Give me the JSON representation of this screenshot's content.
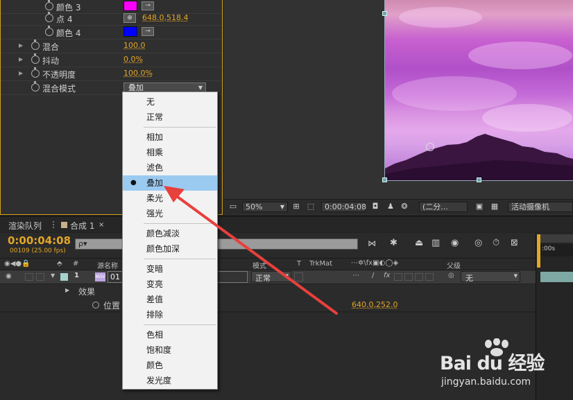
{
  "effect_controls": {
    "rows": [
      {
        "label": "颜色 3",
        "kind": "color",
        "color": "#ff00ff"
      },
      {
        "label": "点 4",
        "kind": "point",
        "value": "648.0,518.4"
      },
      {
        "label": "颜色 4",
        "kind": "color",
        "color": "#0000ff"
      },
      {
        "label": "混合",
        "kind": "value",
        "value": "100.0"
      },
      {
        "label": "抖动",
        "kind": "value",
        "value": "0.0%"
      },
      {
        "label": "不透明度",
        "kind": "value",
        "value": "100.0%"
      },
      {
        "label": "混合模式",
        "kind": "select",
        "value": "叠加"
      }
    ]
  },
  "viewer": {
    "zoom": "50%",
    "timecode": "0:00:04:08",
    "resolution": "(二分...",
    "camera": "活动摄像机"
  },
  "timeline": {
    "tabs": [
      {
        "label": "渲染队列"
      },
      {
        "label": "合成 1"
      }
    ],
    "current_time": "0:00:04:08",
    "frame_info": "00109 (25.00 fps)",
    "search_placeholder": "ρ▾",
    "columns": {
      "num": "#",
      "source_name": "源名称",
      "mode": "模式",
      "t": "T",
      "trkmat": "TrkMat",
      "parent": "父级"
    },
    "layer": {
      "index": "1",
      "name": "01",
      "mode": "正常",
      "parent": "无"
    },
    "effects_label": "效果",
    "position_label": "位置",
    "position_value": "640.0,252.0",
    "ruler_label": ":00s"
  },
  "blend_menu": {
    "groups": [
      [
        "无",
        "正常"
      ],
      [
        "相加",
        "相乘",
        "滤色",
        "叠加",
        "柔光",
        "强光"
      ],
      [
        "颜色减淡",
        "颜色加深"
      ],
      [
        "变暗",
        "变亮",
        "差值",
        "排除"
      ],
      [
        "色相",
        "饱和度",
        "颜色",
        "发光度"
      ]
    ],
    "selected": "叠加"
  },
  "watermark": {
    "brand": "Bai du 经验",
    "url": "jingyan.baidu.com"
  },
  "colors": {
    "accent": "#e3a626",
    "menu_highlight": "#9bcaf0",
    "arrow": "#e8403c"
  }
}
